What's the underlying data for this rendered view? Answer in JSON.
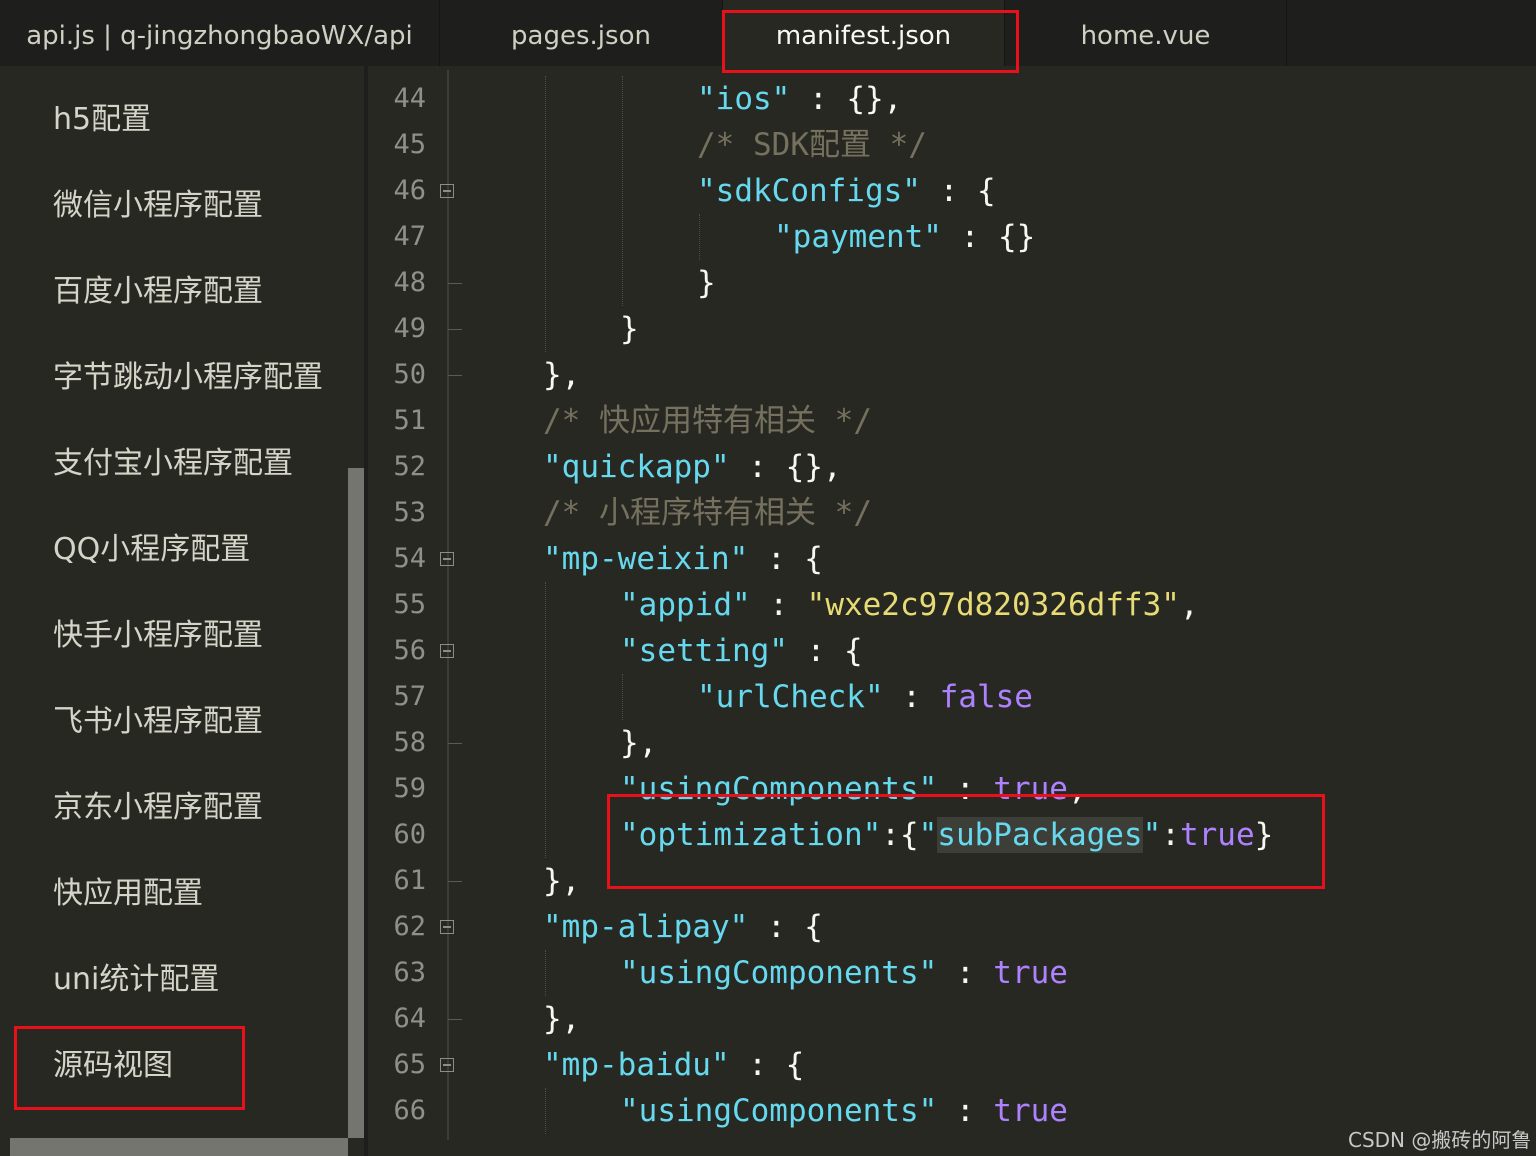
{
  "tabs": [
    "api.js | q-jingzhongbaoWX/api",
    "pages.json",
    "manifest.json",
    "home.vue"
  ],
  "sidebar": {
    "items": [
      "h5配置",
      "微信小程序配置",
      "百度小程序配置",
      "字节跳动小程序配置",
      "支付宝小程序配置",
      "QQ小程序配置",
      "快手小程序配置",
      "飞书小程序配置",
      "京东小程序配置",
      "快应用配置",
      "uni统计配置",
      "源码视图"
    ],
    "selected": "源码视图"
  },
  "editor": {
    "line_numbers": [
      "44",
      "45",
      "46",
      "47",
      "48",
      "49",
      "50",
      "51",
      "52",
      "53",
      "54",
      "55",
      "56",
      "57",
      "58",
      "59",
      "60",
      "61",
      "62",
      "63",
      "64",
      "65",
      "66"
    ],
    "lines": {
      "l44": {
        "key": "\"ios\"",
        "rest": " : {},"
      },
      "l45": {
        "comment": "/* SDK配置 */"
      },
      "l46": {
        "key": "\"sdkConfigs\"",
        "rest": " : {"
      },
      "l47": {
        "key": "\"payment\"",
        "rest": " : {}"
      },
      "l48": {
        "text": "}"
      },
      "l49": {
        "text": "}"
      },
      "l50": {
        "text": "},"
      },
      "l51": {
        "comment": "/* 快应用特有相关 */"
      },
      "l52": {
        "key": "\"quickapp\"",
        "rest": " : {},"
      },
      "l53": {
        "comment": "/* 小程序特有相关 */"
      },
      "l54": {
        "key": "\"mp-weixin\"",
        "rest": " : {"
      },
      "l55": {
        "key": "\"appid\"",
        "sep": " : ",
        "value": "\"wxe2c97d820326dff3\"",
        "tail": ","
      },
      "l56": {
        "key": "\"setting\"",
        "rest": " : {"
      },
      "l57": {
        "key": "\"urlCheck\"",
        "sep": " : ",
        "value": "false"
      },
      "l58": {
        "text": "},"
      },
      "l59": {
        "key": "\"usingComponents\"",
        "sep": " : ",
        "value": "true",
        "tail": ","
      },
      "l60": {
        "p1": "\"optimization\"",
        "p2": ":{",
        "p3": "\"",
        "p4": "subPackages",
        "p5": "\"",
        "p6": ":",
        "p7": "true",
        "p8": "}"
      },
      "l61": {
        "text": "},"
      },
      "l62": {
        "key": "\"mp-alipay\"",
        "rest": " : {"
      },
      "l63": {
        "key": "\"usingComponents\"",
        "sep": " : ",
        "value": "true"
      },
      "l64": {
        "text": "},"
      },
      "l65": {
        "key": "\"mp-baidu\"",
        "rest": " : {"
      },
      "l66": {
        "key": "\"usingComponents\"",
        "sep": " : ",
        "value": "true"
      }
    }
  },
  "colors": {
    "background": "#272822",
    "string_key": "#66d9ef",
    "string_value": "#e6db74",
    "keyword": "#ae81ff",
    "comment": "#75715e",
    "highlight_box": "#e8101b"
  },
  "watermark": "CSDN @搬砖的阿鲁"
}
